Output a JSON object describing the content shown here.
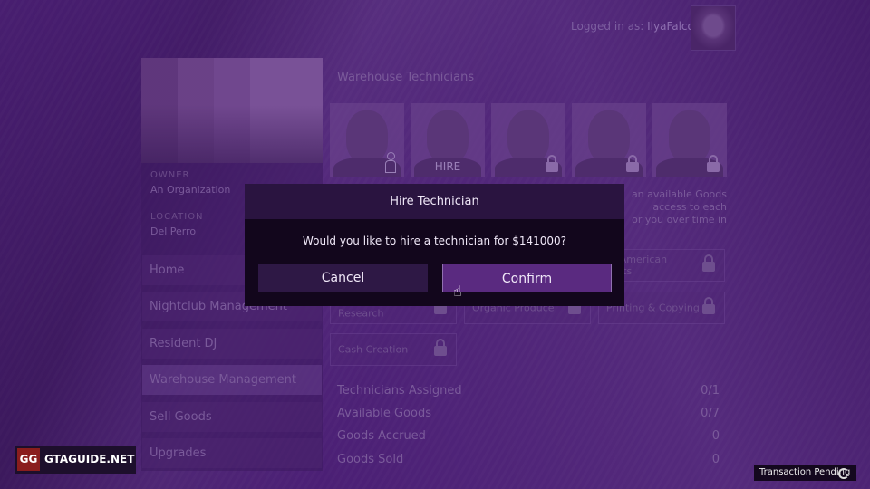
{
  "header": {
    "logged_in_label": "Logged in as:",
    "username": "IlyaFalcon"
  },
  "property": {
    "owner_label": "OWNER",
    "owner": "An Organization",
    "location_label": "LOCATION",
    "location": "Del Perro"
  },
  "sidebar": {
    "items": [
      {
        "label": "Home",
        "active": false
      },
      {
        "label": "Nightclub Management",
        "active": false
      },
      {
        "label": "Resident DJ",
        "active": false
      },
      {
        "label": "Warehouse Management",
        "active": true
      },
      {
        "label": "Sell Goods",
        "active": false
      },
      {
        "label": "Upgrades",
        "active": false
      }
    ]
  },
  "main": {
    "section_title": "Warehouse Technicians",
    "technicians": [
      {
        "state": "hired",
        "icon": "person-icon"
      },
      {
        "state": "hire",
        "label": "HIRE"
      },
      {
        "state": "locked",
        "icon": "lock-icon"
      },
      {
        "state": "locked",
        "icon": "lock-icon"
      },
      {
        "state": "locked",
        "icon": "lock-icon"
      }
    ],
    "description_visible": [
      "an available Goods",
      "access to each",
      "or you over time in"
    ],
    "goods": [
      {
        "label": "South American Imports",
        "visible_label": "th American\nports",
        "locked": true
      },
      {
        "label": "Pharmaceutical Research",
        "visible_label": "Research",
        "locked": true
      },
      {
        "label": "Organic Produce",
        "locked": true
      },
      {
        "label": "Printing & Copying",
        "locked": true
      },
      {
        "label": "Cash Creation",
        "locked": true
      }
    ],
    "stats": [
      {
        "label": "Technicians Assigned",
        "value": "0/1"
      },
      {
        "label": "Available Goods",
        "value": "0/7"
      },
      {
        "label": "Goods Accrued",
        "value": "0"
      },
      {
        "label": "Goods Sold",
        "value": "0"
      }
    ]
  },
  "dialog": {
    "title": "Hire Technician",
    "message": "Would you like to hire a technician for $141000?",
    "cancel_label": "Cancel",
    "confirm_label": "Confirm"
  },
  "watermark": {
    "badge": "GG",
    "site": "GTAGUIDE.NET"
  },
  "status": {
    "text": "Transaction Pending"
  }
}
